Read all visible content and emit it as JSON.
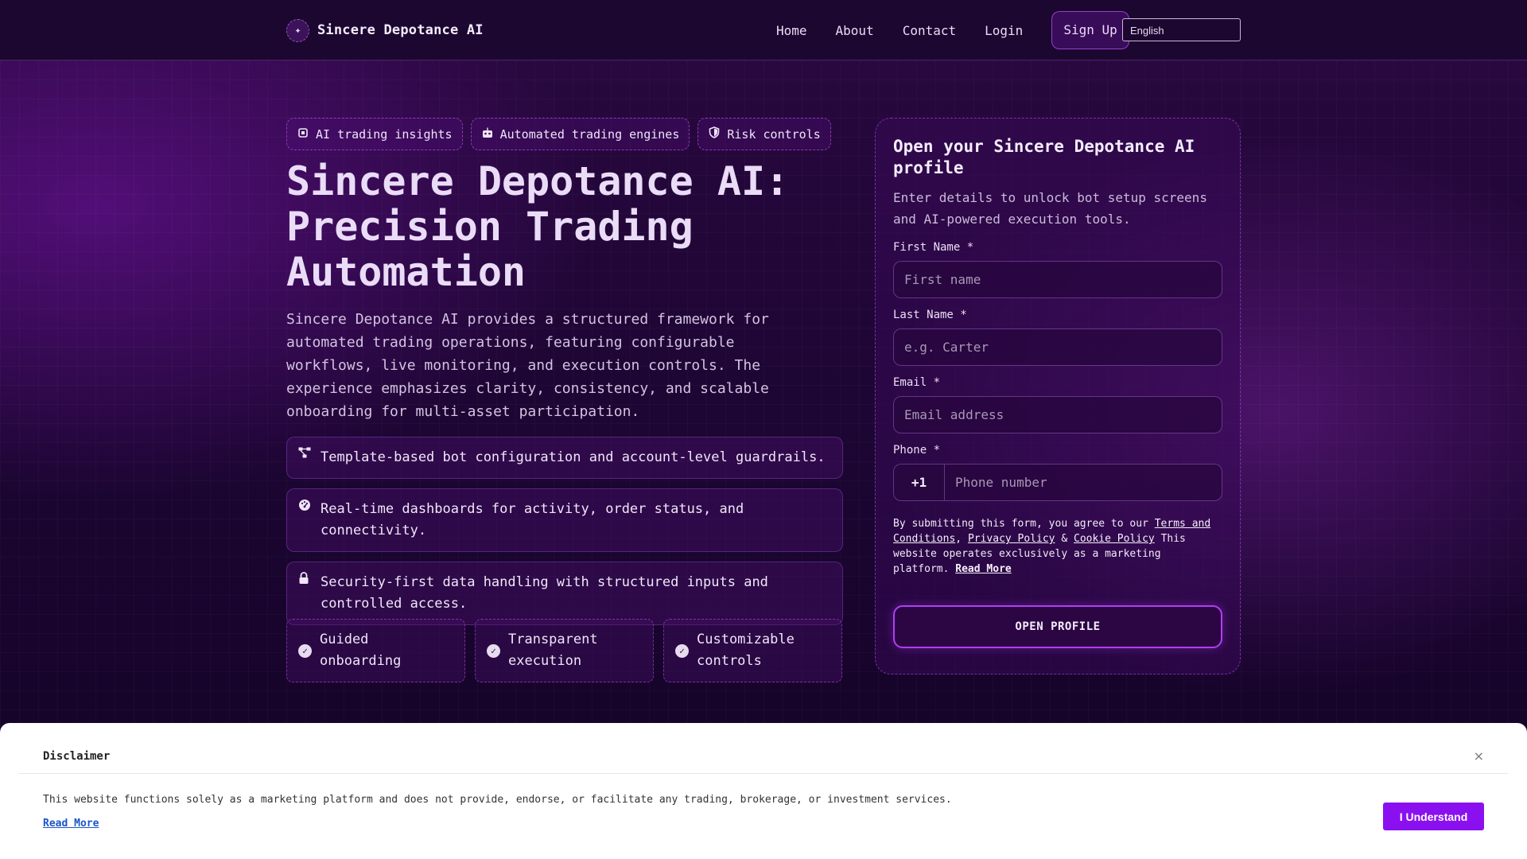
{
  "brand": {
    "icon": "sparkle-icon",
    "name": "Sincere Depotance AI"
  },
  "nav": {
    "home": "Home",
    "about": "About",
    "contact": "Contact",
    "login": "Login",
    "signup": "Sign Up",
    "language": "English"
  },
  "hero": {
    "chips": [
      {
        "icon": "cpu-icon",
        "label": "AI trading insights"
      },
      {
        "icon": "robot-icon",
        "label": "Automated trading engines"
      },
      {
        "icon": "shield-icon",
        "label": "Risk controls"
      }
    ],
    "title": "Sincere Depotance AI: Precision Trading Automation",
    "description": "Sincere Depotance AI provides a structured framework for au­tomated trading operations, featuring configurable workflows, live monitoring, and execution controls. The experience em­phasizes clarity, consistency, and scalable onboarding for multi-asset participation.",
    "features": [
      {
        "icon": "workflow-icon",
        "text": "Template-based bot configuration and account-level guardrails."
      },
      {
        "icon": "dashboard-icon",
        "text": "Real-time dashboards for activity, order status, and connectivity."
      },
      {
        "icon": "lock-icon",
        "text": "Security-first data handling with structured inputs and controlled access."
      }
    ],
    "badges": [
      {
        "icon": "check-icon",
        "label": "Guided onboarding"
      },
      {
        "icon": "check-icon",
        "label": "Transparent execution"
      },
      {
        "icon": "check-icon",
        "label": "Customizable controls"
      }
    ]
  },
  "form": {
    "title": "Open your Sincere Depotance AI profile",
    "subtitle": "Enter details to unlock bot setup screens and AI-powered execution tools.",
    "first_name_label": "First Name *",
    "first_name_placeholder": "First name",
    "last_name_label": "Last Name *",
    "last_name_placeholder": "e.g. Carter",
    "email_label": "Email *",
    "email_placeholder": "Email address",
    "phone_label": "Phone *",
    "phone_code": "+1",
    "phone_placeholder": "Phone number",
    "legal_prefix": "By submitting this form, you agree to our ",
    "terms": "Terms and Conditions",
    "comma": ", ",
    "privacy": "Privacy Policy",
    "amp": " & ",
    "cookie": "Cookie Policy",
    "legal_note": " This website operates exclusively as a marketing platform. ",
    "read_more": "Read More",
    "submit": "OPEN PROFILE"
  },
  "disclaimer": {
    "title": "Disclaimer",
    "close": "×",
    "text": "This website functions solely as a marketing platform and does not provide, endorse, or facilitate any trading, brokerage, or investment services.",
    "read_more": "Read More",
    "button": "I Understand"
  },
  "colors": {
    "accent": "#8a10f0",
    "background": "#1a0530",
    "link": "#1a55c8"
  }
}
